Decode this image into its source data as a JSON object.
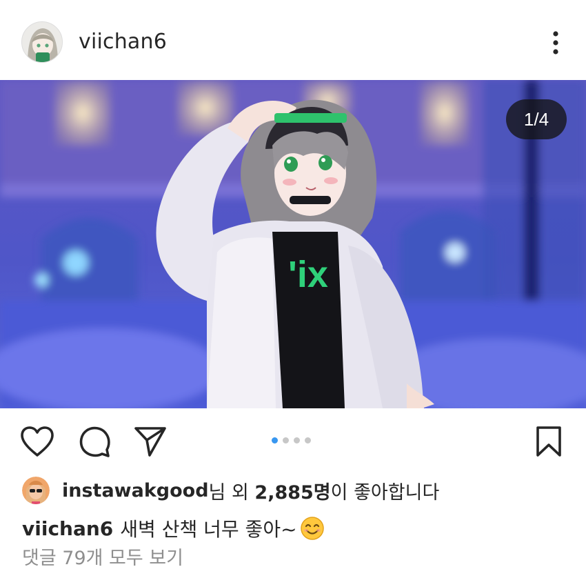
{
  "post": {
    "username": "viichan6",
    "image_counter": "1/4",
    "carousel": {
      "total": 4,
      "active_index": 0
    }
  },
  "likes": {
    "liker": "instawakgood",
    "middle": "님 외 ",
    "count": "2,885명",
    "suffix": "이 좋아합니다"
  },
  "caption": {
    "username": "viichan6",
    "text": "새벽 산책 너무 좋아~",
    "emoji": "smiling-face-icon"
  },
  "comments": {
    "view_all": "댓글 79개 모두 보기"
  },
  "icons": {
    "like": "heart-icon",
    "comment": "comment-icon",
    "share": "paper-plane-icon",
    "save": "bookmark-icon",
    "more": "more-vertical-icon"
  },
  "colors": {
    "text": "#262626",
    "muted": "#8e8e8e",
    "dot_active": "#3897f0",
    "dot_inactive": "#c7c7c7"
  }
}
